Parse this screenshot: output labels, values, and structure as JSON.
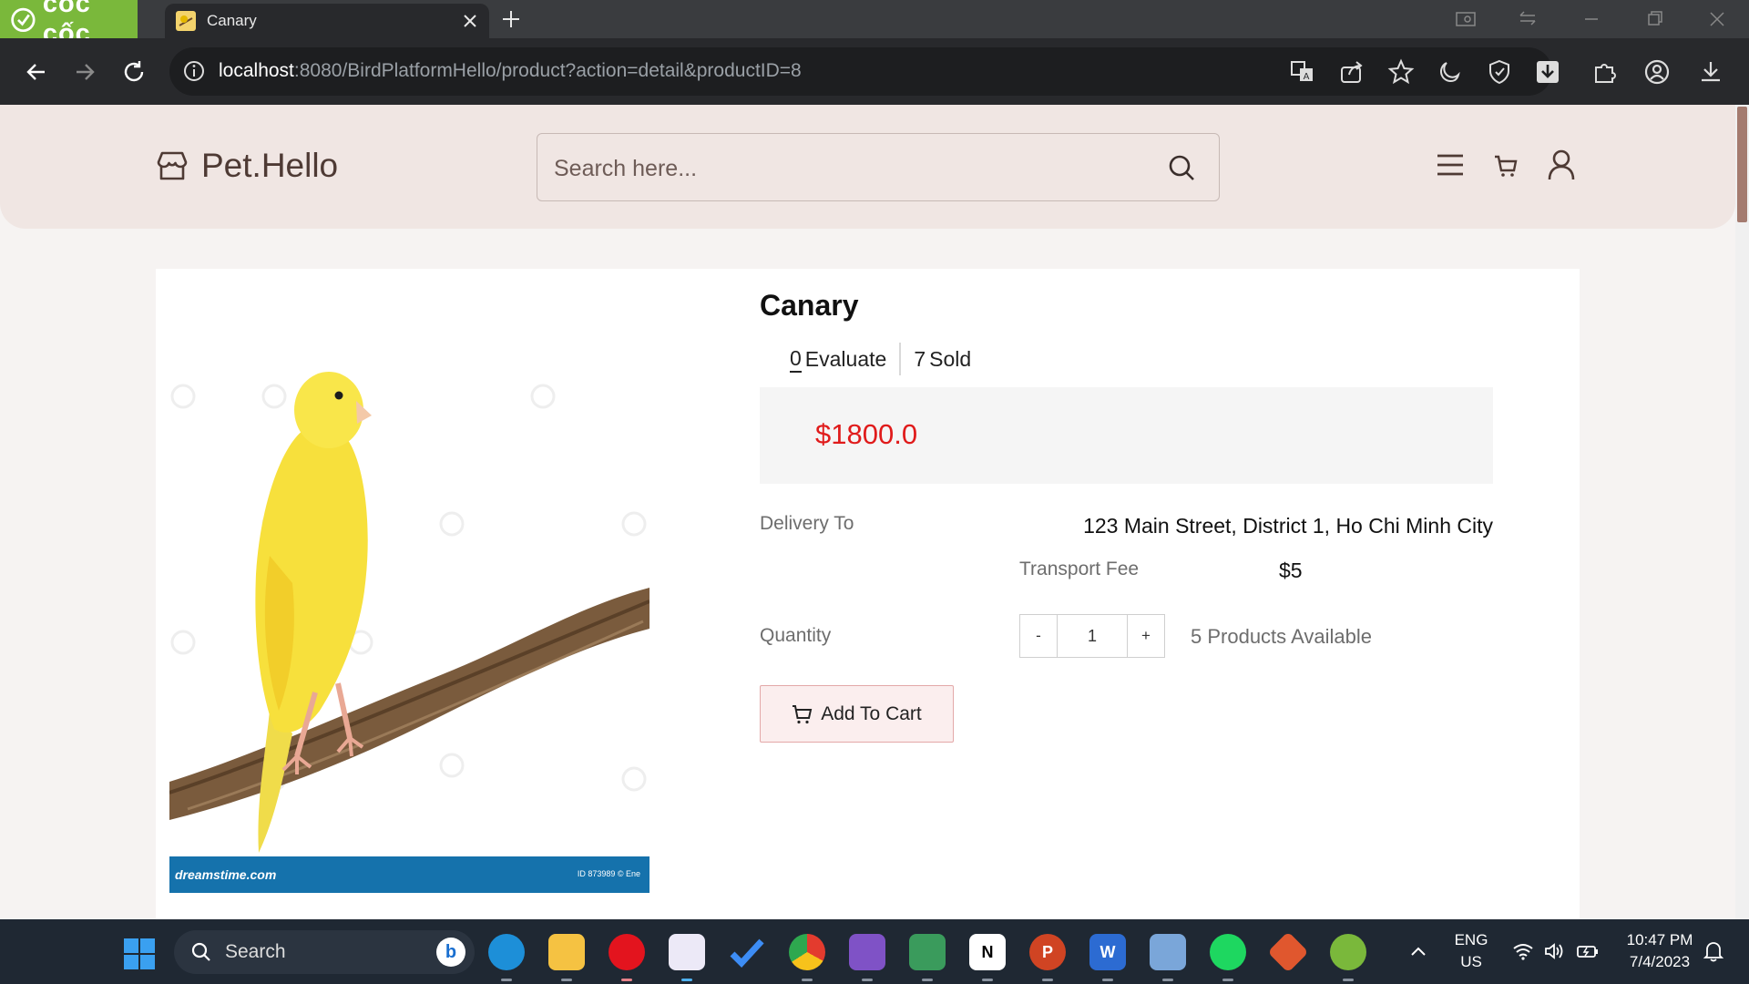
{
  "browser": {
    "brand": "cốc cốc",
    "tab_title": "Canary",
    "url_host": "localhost",
    "url_rest": ":8080/BirdPlatformHello/product?action=detail&productID=8"
  },
  "site": {
    "logo_text": "Pet.Hello",
    "search_placeholder": "Search here..."
  },
  "product": {
    "name": "Canary",
    "evaluate_count": "0",
    "evaluate_label": "Evaluate",
    "sold_count": "7",
    "sold_label": "Sold",
    "price": "$1800.0",
    "delivery_label": "Delivery To",
    "delivery_address": "123 Main Street, District 1, Ho Chi Minh City",
    "transport_fee_label": "Transport Fee",
    "transport_fee": "$5",
    "quantity_label": "Quantity",
    "quantity_decrement": "-",
    "quantity_value": "1",
    "quantity_increment": "+",
    "available": "5 Products Available",
    "add_to_cart": "Add To Cart",
    "image_watermark_left": "dreamstime.com",
    "image_watermark_right": "ID 873989 © Ene"
  },
  "taskbar": {
    "search_label": "Search",
    "language_line1": "ENG",
    "language_line2": "US",
    "time": "10:47 PM",
    "date": "7/4/2023"
  },
  "colors": {
    "brand_green": "#7ab83b",
    "header_bg": "#f0e6e3",
    "price_red": "#e01b1b",
    "cart_button_bg": "#fbeeee"
  }
}
